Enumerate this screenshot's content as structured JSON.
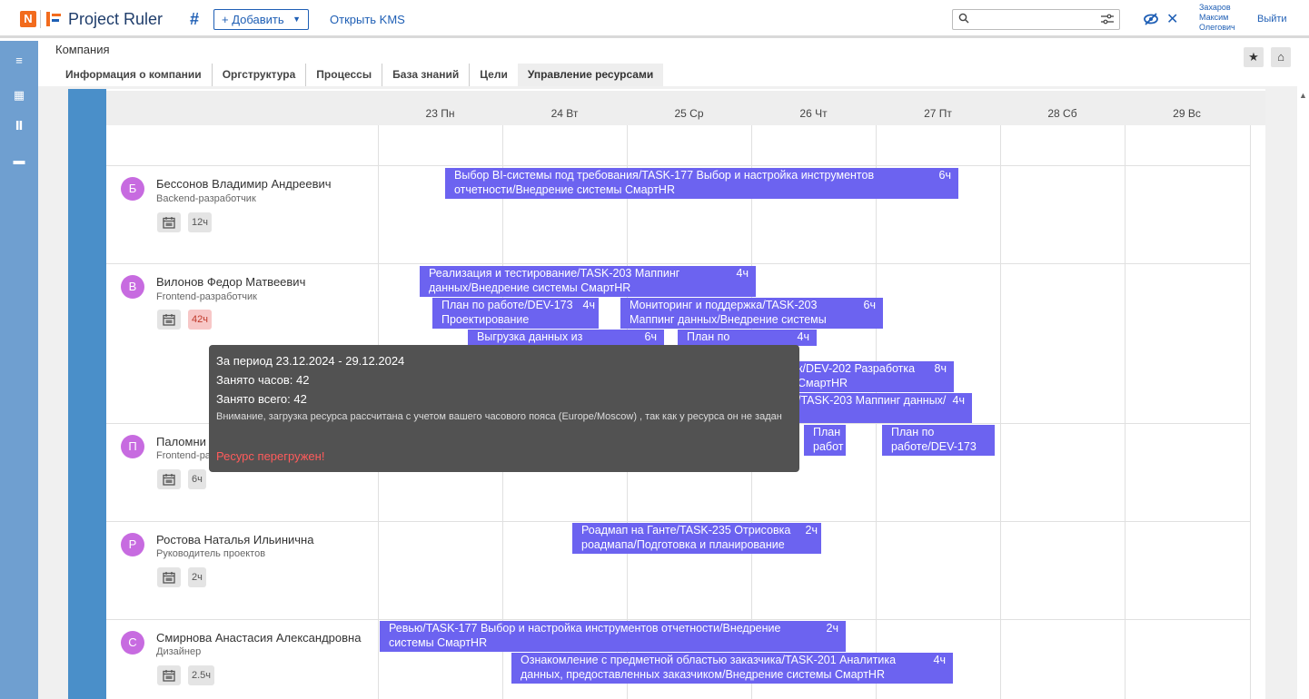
{
  "topbar": {
    "logo_letter": "N",
    "brand": "Project Ruler",
    "add_label": "+ Добавить",
    "kms_label": "Открыть KMS",
    "search_value": "",
    "user_name_line1": "Захаров",
    "user_name_line2": "Максим",
    "user_name_line3": "Олегович",
    "logout_label": "Выйти"
  },
  "header": {
    "breadcrumb": "Компания",
    "tabs": [
      {
        "label": "Информация о компании"
      },
      {
        "label": "Оргструктура"
      },
      {
        "label": "Процессы"
      },
      {
        "label": "База знаний"
      },
      {
        "label": "Цели"
      },
      {
        "label": "Управление ресурсами",
        "active": true
      }
    ]
  },
  "days": [
    {
      "label": "23 Пн"
    },
    {
      "label": "24 Вт"
    },
    {
      "label": "25 Ср"
    },
    {
      "label": "26 Чт"
    },
    {
      "label": "27 Пт"
    },
    {
      "label": "28 Сб"
    },
    {
      "label": "29 Вс"
    }
  ],
  "people": [
    {
      "initial": "Б",
      "name": "Бессонов Владимир Андреевич",
      "role": "Backend-разработчик",
      "hours": "12ч",
      "overloaded": false
    },
    {
      "initial": "В",
      "name": "Вилонов Федор Матвеевич",
      "role": "Frontend-разработчик",
      "hours": "42ч",
      "overloaded": true
    },
    {
      "initial": "П",
      "name": "Паломни",
      "role": "Frontend-ра",
      "hours": "6ч",
      "overloaded": false
    },
    {
      "initial": "Р",
      "name": "Ростова Наталья Ильинична",
      "role": "Руководитель проектов",
      "hours": "2ч",
      "overloaded": false
    },
    {
      "initial": "С",
      "name": "Смирнова Анастасия Александровна",
      "role": "Дизайнер",
      "hours": "2.5ч",
      "overloaded": false
    }
  ],
  "tasks": [
    {
      "line1": "Выбор BI-системы под требования/TASK-177 Выбор и настройка инструментов",
      "line2": "отчетности/Внедрение системы СмартHR",
      "hours": "6ч"
    },
    {
      "line1": "Реализация и тестирование/TASK-203 Маппинг",
      "line2": "данных/Внедрение системы СмартHR",
      "hours": "4ч"
    },
    {
      "line1": "План по работе/DEV-173",
      "line2": "Проектирование",
      "hours": "4ч"
    },
    {
      "line1": "Мониторинг и поддержка/TASK-203",
      "line2": "Маппинг данных/Внедрение системы",
      "hours": "6ч"
    },
    {
      "line1": "Выгрузка данных из",
      "line2": "",
      "hours": "6ч"
    },
    {
      "line1": "План по",
      "line2": "",
      "hours": "4ч"
    },
    {
      "line1": "к/DEV-202 Разработка",
      "line2": "СмартHR",
      "hours": "8ч"
    },
    {
      "line1": "/TASK-203 Маппинг данных/",
      "line2": "",
      "hours": "4ч"
    },
    {
      "line1": "План",
      "line2": "работ",
      "hours": ""
    },
    {
      "line1": "План по",
      "line2": "работе/DEV-173",
      "hours": ""
    },
    {
      "line1": "Роадмап на Ганте/TASK-235 Отрисовка",
      "line2": "роадмапа/Подготовка и планирование",
      "hours": "2ч"
    },
    {
      "line1": "Ревью/TASK-177 Выбор и настройка инструментов отчетности/Внедрение",
      "line2": "системы СмартHR",
      "hours": "2ч"
    },
    {
      "line1": "Ознакомление с предметной областью заказчика/TASK-201 Аналитика",
      "line2": "данных, предоставленных заказчиком/Внедрение системы СмартHR",
      "hours": "4ч"
    }
  ],
  "tooltip": {
    "period": "За период 23.12.2024 - 29.12.2024",
    "busy_hours": "Занято часов: 42",
    "busy_total": "Занято всего: 42",
    "warning": "Внимание, загрузка ресурса рассчитана с учетом вашего часового пояса (Europe/Moscow) , так как у ресурса он не задан",
    "overloaded": "Ресурс перегружен!"
  },
  "colors": {
    "accent": "#1f5fb5",
    "brand_orange": "#f26b1d",
    "sidebar": "#6f9fd0",
    "task": "#6c63f0",
    "avatar": "#c76be0",
    "overload": "#ff5b5b"
  }
}
